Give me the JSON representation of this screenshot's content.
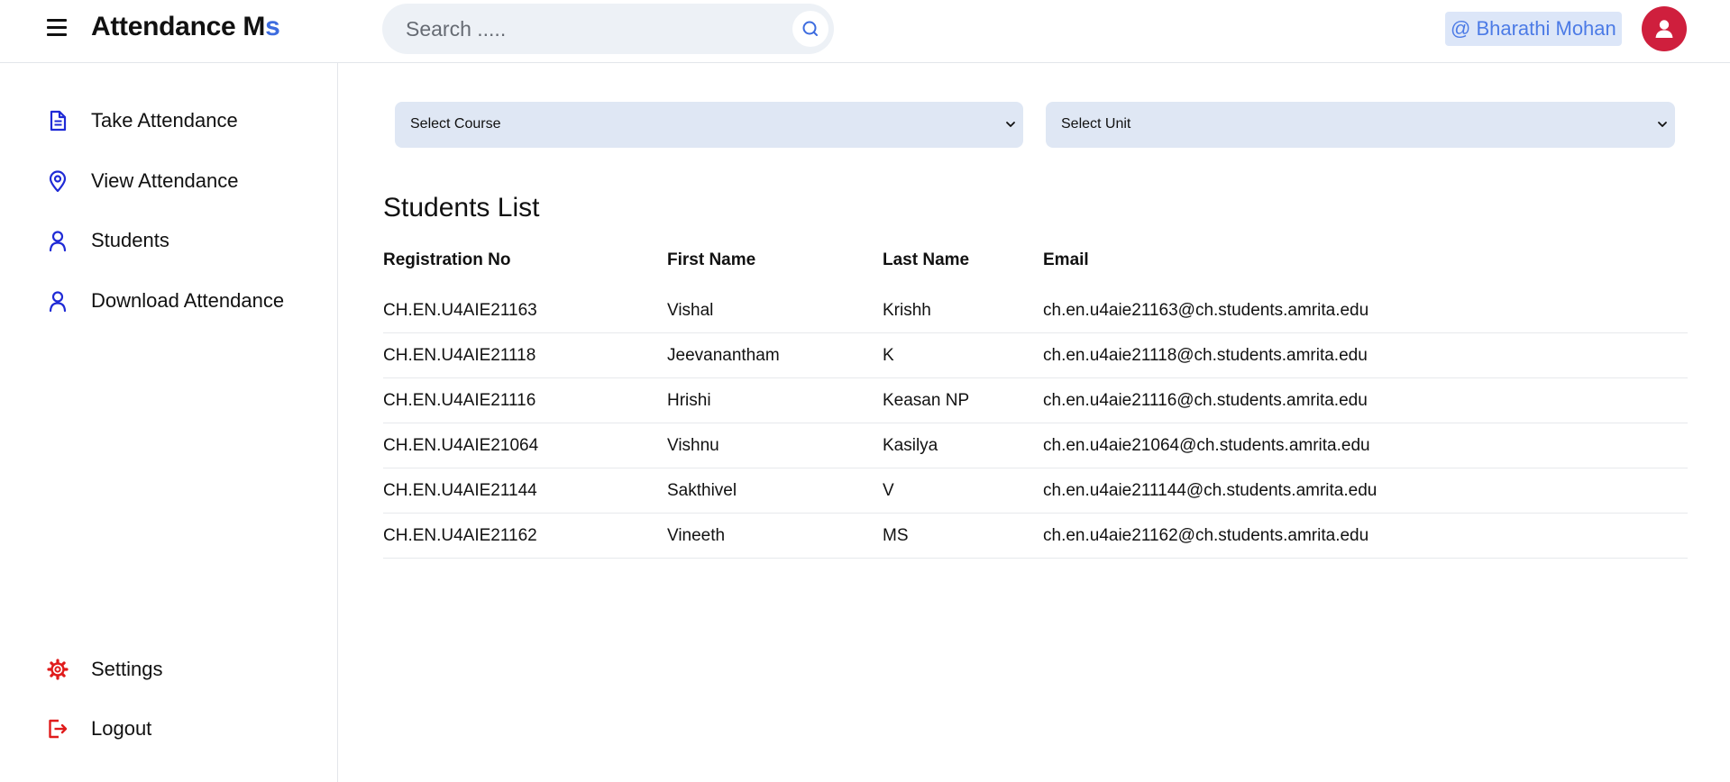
{
  "header": {
    "brand_main": "Attendance M",
    "brand_accent": "s",
    "search_placeholder": "Search .....",
    "user_tag": "@ Bharathi Mohan"
  },
  "sidebar": {
    "items": [
      {
        "label": "Take Attendance",
        "icon": "document-icon"
      },
      {
        "label": "View Attendance",
        "icon": "location-pin-icon"
      },
      {
        "label": "Students",
        "icon": "user-icon"
      },
      {
        "label": "Download Attendance",
        "icon": "user-icon"
      }
    ],
    "bottom": [
      {
        "label": "Settings",
        "icon": "gear-icon"
      },
      {
        "label": "Logout",
        "icon": "logout-icon"
      }
    ]
  },
  "filters": {
    "course": "Select Course",
    "unit": "Select Unit"
  },
  "students": {
    "title": "Students List",
    "columns": [
      "Registration No",
      "First Name",
      "Last Name",
      "Email"
    ],
    "rows": [
      [
        "CH.EN.U4AIE21163",
        "Vishal",
        "Krishh",
        "ch.en.u4aie21163@ch.students.amrita.edu"
      ],
      [
        "CH.EN.U4AIE21118",
        "Jeevanantham",
        "K",
        "ch.en.u4aie21118@ch.students.amrita.edu"
      ],
      [
        "CH.EN.U4AIE21116",
        "Hrishi",
        "Keasan NP",
        "ch.en.u4aie21116@ch.students.amrita.edu"
      ],
      [
        "CH.EN.U4AIE21064",
        "Vishnu",
        "Kasilya",
        "ch.en.u4aie21064@ch.students.amrita.edu"
      ],
      [
        "CH.EN.U4AIE21144",
        "Sakthivel",
        "V",
        "ch.en.u4aie211144@ch.students.amrita.edu"
      ],
      [
        "CH.EN.U4AIE21162",
        "Vineeth",
        "MS",
        "ch.en.u4aie21162@ch.students.amrita.edu"
      ]
    ]
  },
  "colors": {
    "accent": "#3d6cdf",
    "nav_icon": "#1f2ad6",
    "danger_icon": "#e01b1b",
    "avatar": "#cf1f3d",
    "select_bg": "#dfe7f4"
  }
}
